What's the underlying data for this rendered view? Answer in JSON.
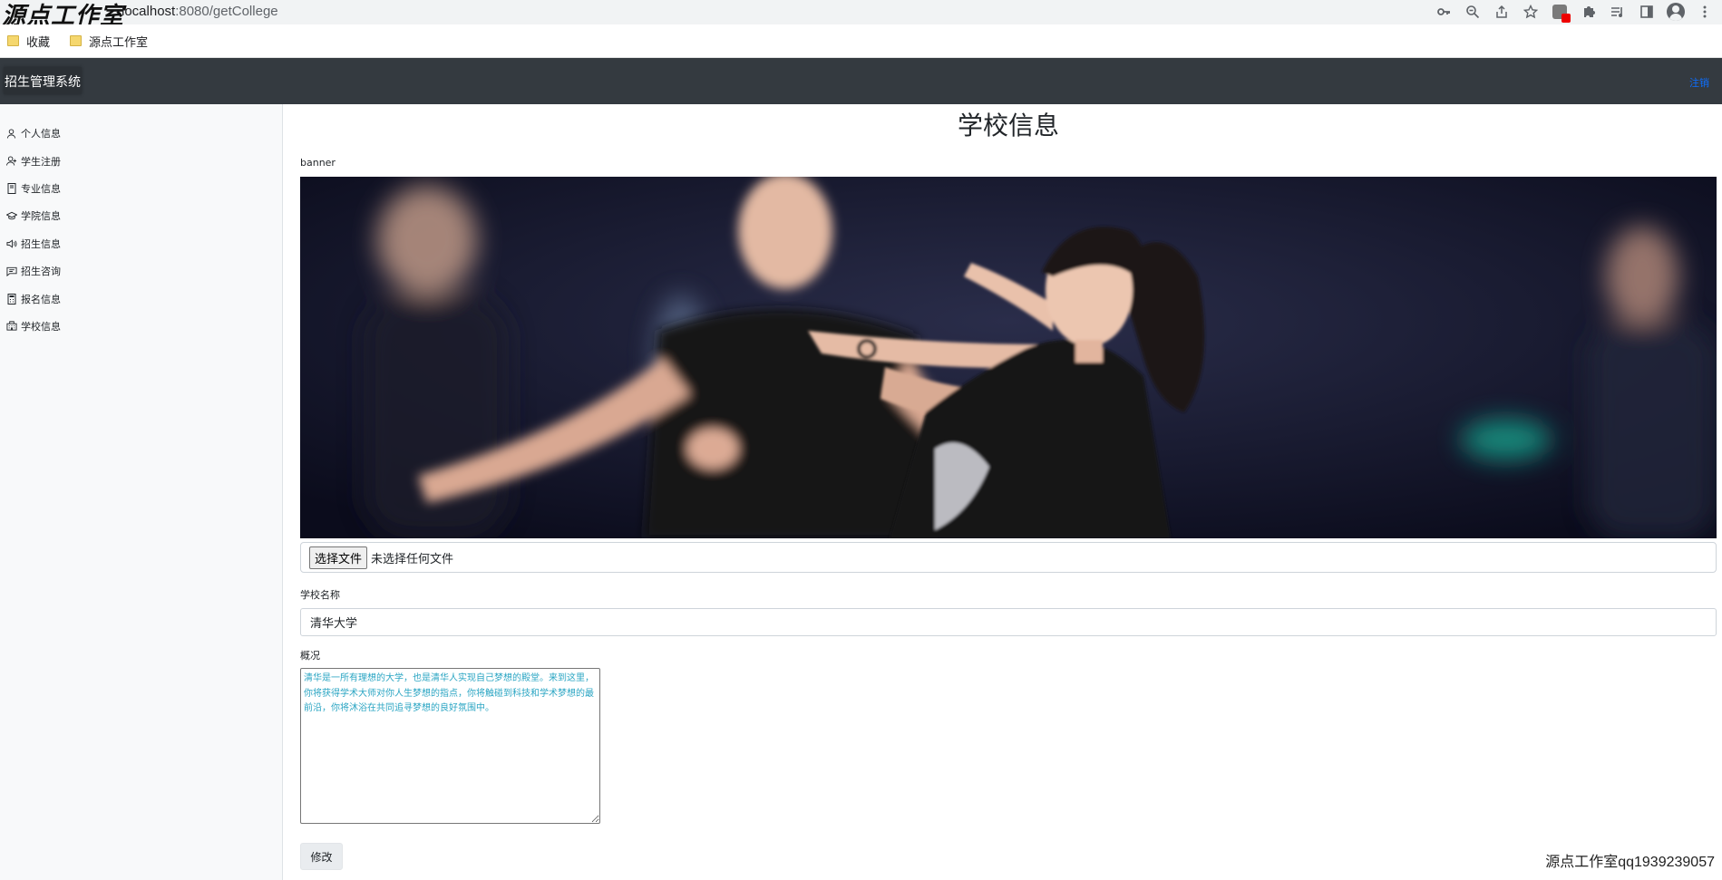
{
  "browser": {
    "watermark": "源点工作室",
    "url_host": "localhost",
    "url_path": ":8080/getCollege",
    "bookmarks": [
      "收藏",
      "源点工作室"
    ]
  },
  "navbar": {
    "brand": "招生管理系统",
    "logout": "注销"
  },
  "sidebar": {
    "items": [
      {
        "label": "个人信息",
        "icon": "person-icon"
      },
      {
        "label": "学生注册",
        "icon": "person-add-icon"
      },
      {
        "label": "专业信息",
        "icon": "book-icon"
      },
      {
        "label": "学院信息",
        "icon": "mortarboard-icon"
      },
      {
        "label": "招生信息",
        "icon": "megaphone-icon"
      },
      {
        "label": "招生咨询",
        "icon": "chat-icon"
      },
      {
        "label": "报名信息",
        "icon": "calculator-icon"
      },
      {
        "label": "学校信息",
        "icon": "building-icon"
      }
    ]
  },
  "main": {
    "title": "学校信息",
    "banner_label": "banner",
    "file": {
      "button": "选择文件",
      "status": "未选择任何文件"
    },
    "name_label": "学校名称",
    "name_value": "清华大学",
    "desc_label": "概况",
    "desc_value": "清华是一所有理想的大学，也是清华人实现自己梦想的殿堂。来到这里，你将获得学术大师对你人生梦想的指点，你将触碰到科技和学术梦想的最前沿，你将沐浴在共同追寻梦想的良好氛围中。",
    "submit": "修改"
  },
  "footer": {
    "watermark": "源点工作室qq1939239057"
  }
}
